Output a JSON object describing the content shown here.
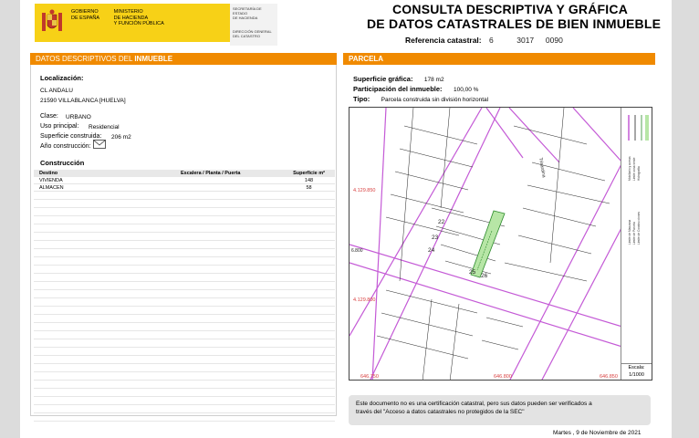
{
  "header": {
    "gobierno_lines": [
      "GOBIERNO",
      "DE ESPAÑA"
    ],
    "ministerio_lines": [
      "MINISTERIO",
      "DE HACIENDA",
      "Y FUNCIÓN PÚBLICA"
    ],
    "secretaria_lines": [
      "SECRETARÍA DE ESTADO",
      "DE HACIENDA"
    ],
    "direccion_lines": [
      "DIRECCIÓN GENERAL",
      "DEL CATASTRO"
    ],
    "title_line1": "CONSULTA DESCRIPTIVA Y GRÁFICA",
    "title_line2": "DE DATOS CATASTRALES DE BIEN INMUEBLE",
    "ref_label": "Referencia catastral:",
    "ref_value": "6      3017   0090"
  },
  "left": {
    "section_title_prefix": "DATOS DESCRIPTIVOS DEL ",
    "section_title_bold": "INMUEBLE",
    "localizacion_label": "Localización:",
    "address_line1": "CL ANDALU",
    "address_line2": "21590 VILLABLANCA [HUELVA]",
    "clase_label": "Clase:",
    "clase_value": "URBANO",
    "uso_label": "Uso principal:",
    "uso_value": "Residencial",
    "superficie_label": "Superficie construida:",
    "superficie_value": "206 m2",
    "anio_label": "Año construcción:",
    "anio_value": "",
    "construccion_label": "Construcción",
    "table_headers": [
      "Destino",
      "Escalera / Planta / Puerta",
      "Superficie m²"
    ],
    "table_rows": [
      {
        "destino": "VIVIENDA",
        "planta": "",
        "superficie": "148"
      },
      {
        "destino": "ALMACEN",
        "planta": "",
        "superficie": "58"
      }
    ]
  },
  "right": {
    "section_title": "PARCELA",
    "superficie_grafica_label": "Superficie gráfica:",
    "superficie_grafica_value": "178 m2",
    "participacion_label": "Participación del inmueble:",
    "participacion_value": "100,00 %",
    "tipo_label": "Tipo:",
    "tipo_value": "Parcela construida sin división horizontal"
  },
  "map": {
    "coord_labels": [
      "4.129.850",
      "4.129.800",
      "646.750",
      "646.800",
      "646.850"
    ],
    "parcel_numbers": [
      "22",
      "23",
      "24",
      "25",
      "26"
    ],
    "street_labels": [
      "Trisardina",
      "6.800"
    ],
    "escala_label": "Escala:",
    "escala_value": "1/1000",
    "legend_items": [
      "Límite de Manzana",
      "Límite de Parcela",
      "Límite de Construcciones",
      "Mobiliario y aceras",
      "Límite zona verde",
      "Hidrografía"
    ],
    "colors": {
      "lines": "#c45ad6",
      "parcel_fill": "#b7e6a6",
      "coords": "#d94040"
    }
  },
  "footer": {
    "disclaimer_line1": "Este documento no es una certificación catastral, pero sus datos pueden ser verificados a",
    "disclaimer_line2": "través del \"Acceso a datos catastrales no protegidos de la SEC\"",
    "date": "Martes , 9 de Noviembre de 2021"
  }
}
